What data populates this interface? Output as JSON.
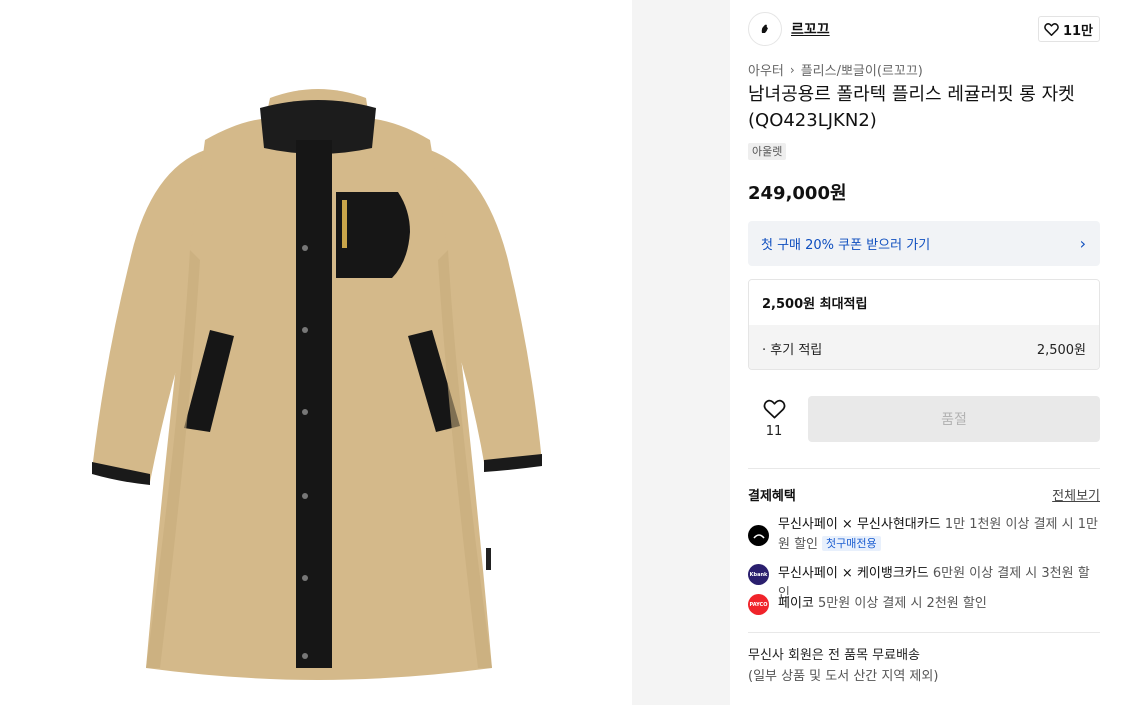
{
  "brand": {
    "name": "르꼬끄",
    "likes": "11만"
  },
  "breadcrumb": [
    "아우터",
    "플리스/뽀글이(르꼬끄)"
  ],
  "product": {
    "title": "남녀공용르 폴라텍 플리스 레귤러핏 롱 자켓 (QO423LJKN2)",
    "tag": "아울렛",
    "price": "249,000원"
  },
  "coupon": {
    "label": "첫 구매 20% 쿠폰 받으러 가기"
  },
  "points": {
    "max_label": "2,500원 최대적립",
    "rows": [
      {
        "label": "· 후기 적립",
        "value": "2,500원"
      }
    ]
  },
  "wish": {
    "count": "11"
  },
  "purchase": {
    "soldout_label": "품절"
  },
  "benefits": {
    "title": "결제혜택",
    "view_all": "전체보기",
    "items": [
      {
        "name": "무신사페이 × 무신사현대카드",
        "desc": "1만 1천원 이상 결제 시 1만원 할인",
        "badge": "첫구매전용",
        "icon_color": "#000000",
        "icon": "card-icon"
      },
      {
        "name": "무신사페이 × 케이뱅크카드",
        "desc": "6만원 이상 결제 시 3천원 할인",
        "icon_color": "#2a1f6e",
        "icon": "kbank-icon",
        "icon_text": "Kbank"
      },
      {
        "name": "페이코",
        "desc": "5만원 이상 결제 시 2천원 할인",
        "icon_color": "#f0232a",
        "icon": "payco-icon",
        "icon_text": "PAYCO"
      }
    ]
  },
  "shipping": {
    "title": "무신사 회원은 전 품목 무료배송",
    "note": "(일부 상품 및 도서 산간 지역 제외)"
  }
}
